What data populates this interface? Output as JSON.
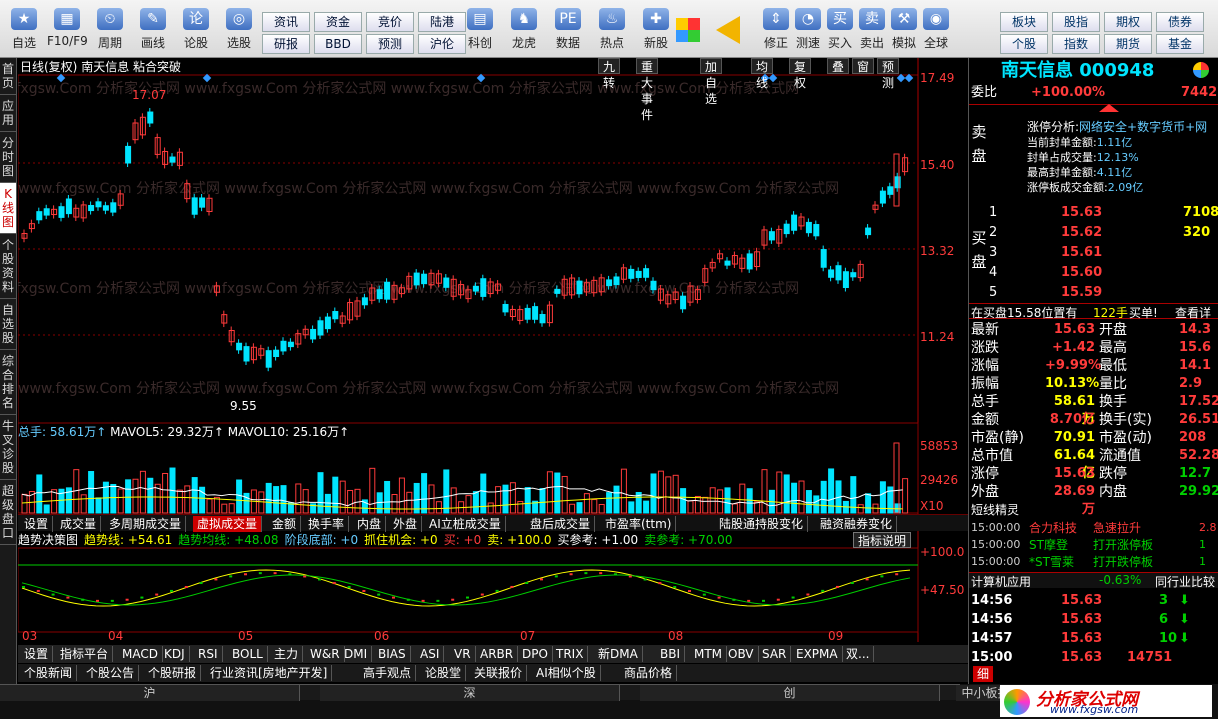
{
  "toolbar": {
    "left": [
      {
        "label": "自选",
        "icon": "★"
      },
      {
        "label": "F10/F9",
        "icon": "▦"
      },
      {
        "label": "周期",
        "icon": "⏲"
      },
      {
        "label": "画线",
        "icon": "✎"
      },
      {
        "label": "论股",
        "icon": "论"
      },
      {
        "label": "选股",
        "icon": "◎"
      }
    ],
    "grid": [
      "资讯",
      "资金",
      "竞价",
      "陆港",
      "研报",
      "BBD",
      "预测",
      "沪伦"
    ],
    "mid": [
      {
        "label": "科创",
        "icon": "▤"
      },
      {
        "label": "龙虎",
        "icon": "♞"
      },
      {
        "label": "数据",
        "icon": "PE"
      },
      {
        "label": "热点",
        "icon": "♨"
      },
      {
        "label": "新股",
        "icon": "✚"
      }
    ],
    "right": [
      {
        "label": "修正",
        "icon": "⇕"
      },
      {
        "label": "测速",
        "icon": "◔"
      },
      {
        "label": "买入",
        "icon": "买"
      },
      {
        "label": "卖出",
        "icon": "卖"
      },
      {
        "label": "模拟",
        "icon": "⚒"
      },
      {
        "label": "全球",
        "icon": "◉"
      }
    ],
    "grid2": [
      "板块",
      "股指",
      "期权",
      "债券",
      "个股",
      "指数",
      "期货",
      "基金"
    ]
  },
  "left_nav": [
    "首页",
    "应用",
    "分时图",
    "K线图",
    "个股资料",
    "自选股",
    "综合排名",
    "牛叉诊股",
    "超级盘口"
  ],
  "chart": {
    "title": "日线(复权)",
    "stock": "南天信息",
    "pattern": "粘合突破",
    "top_buttons": [
      "九转",
      "重大事件",
      "加自选",
      "均线",
      "复权",
      "叠",
      "窗",
      "预测"
    ],
    "price_ticks": [
      "17.49",
      "15.40",
      "13.32",
      "11.24"
    ],
    "high_label": "17.07",
    "low_label": "9.55",
    "vol_label": "总手: 58.61万↑",
    "mavol5": "MAVOL5: 29.32万↑",
    "mavol10": "MAVOL10: 25.16万↑",
    "vol_ticks": [
      "58853",
      "29426",
      "X10"
    ],
    "tabs1": [
      "设置",
      "成交量",
      "多周期成交量",
      "虚拟成交量",
      "金额",
      "换手率",
      "内盘",
      "外盘",
      "AI立桩成交量",
      "盘后成交量",
      "市盈率(ttm)",
      "陆股通持股变化",
      "融资融券变化"
    ],
    "ind_title": "趋势决策图",
    "ind_vals": [
      {
        "t": "趋势线: +54.61",
        "c": "y"
      },
      {
        "t": "趋势均线: +48.08",
        "c": "g"
      },
      {
        "t": "阶段底部: +0",
        "c": "c"
      },
      {
        "t": "抓住机会: +0",
        "c": "y"
      },
      {
        "t": "买: +0",
        "c": "r"
      },
      {
        "t": "卖: +100.0",
        "c": "y"
      },
      {
        "t": "买参考: +1.00",
        "c": "w"
      },
      {
        "t": "卖参考: +70.00",
        "c": "g"
      }
    ],
    "ind_btn": "指标说明",
    "ind_ticks": [
      "+100.0",
      "+47.50"
    ],
    "months": [
      "03",
      "04",
      "05",
      "06",
      "07",
      "08",
      "09"
    ],
    "tabs2": [
      "设置",
      "指标平台",
      "MACD",
      "KDJ",
      "RSI",
      "BOLL",
      "主力",
      "W&R",
      "DMI",
      "BIAS",
      "ASI",
      "VR",
      "ARBR",
      "DPO",
      "TRIX",
      "新DMA",
      "BBI",
      "MTM",
      "OBV",
      "SAR",
      "EXPMA",
      "双..."
    ],
    "tabs3": [
      "个股新闻",
      "个股公告",
      "个股研报",
      "行业资讯[房地产开发]",
      "高手观点",
      "论股堂",
      "关联报价",
      "AI相似个股",
      "商品价格"
    ],
    "watermark": "www.fxgsw.Com 分析家公式网"
  },
  "panel": {
    "name": "南天信息",
    "code": "000948",
    "webi_label": "委比",
    "webi": "+100.00%",
    "webi_r": "7442",
    "limit_title": "涨停分析:",
    "limit_tags": "网络安全+数字货币+网",
    "limit_lines": [
      [
        "当前封单金额:",
        "1.11亿"
      ],
      [
        "封单占成交量:",
        "12.13%"
      ],
      [
        "最高封单金额:",
        "4.11亿"
      ],
      [
        "涨停板成交金额:",
        "2.09亿"
      ]
    ],
    "sell_label": "卖盘",
    "buy_label": "买盘",
    "bids": [
      [
        "1",
        "15.63",
        "7108"
      ],
      [
        "2",
        "15.62",
        "320"
      ],
      [
        "3",
        "15.61",
        ""
      ],
      [
        "4",
        "15.60",
        ""
      ],
      [
        "5",
        "15.59",
        ""
      ]
    ],
    "note": [
      "在买盘15.58位置有",
      "122手",
      "买单!",
      "查看详"
    ],
    "stats": [
      [
        "最新",
        "15.63",
        "开盘",
        "14.3"
      ],
      [
        "涨跌",
        "+1.42",
        "最高",
        "15.6"
      ],
      [
        "涨幅",
        "+9.99%",
        "最低",
        "14.1"
      ],
      [
        "振幅",
        "10.13%",
        "量比",
        "2.9"
      ],
      [
        "总手",
        "58.61万",
        "换手",
        "17.52"
      ],
      [
        "金额",
        "8.70亿",
        "换手(实)",
        "26.51"
      ],
      [
        "市盈(静)",
        "70.91",
        "市盈(动)",
        "208"
      ],
      [
        "总市值",
        "61.64亿",
        "流通值",
        "52.28"
      ],
      [
        "涨停",
        "15.63",
        "跌停",
        "12.7"
      ],
      [
        "外盘",
        "28.69万",
        "内盘",
        "29.92"
      ]
    ],
    "dx_title": "短线精灵",
    "dx": [
      [
        "15:00:00",
        "合力科技",
        "急速拉升",
        "2.8"
      ],
      [
        "15:00:00",
        "ST摩登",
        "打开涨停板",
        "1"
      ],
      [
        "15:00:00",
        "*ST雪莱",
        "打开跌停板",
        "1"
      ]
    ],
    "industry": [
      "计算机应用",
      "-0.63%",
      "同行业比较"
    ],
    "ticks": [
      [
        "14:56",
        "15.63",
        "3"
      ],
      [
        "14:56",
        "15.63",
        "6"
      ],
      [
        "14:57",
        "15.63",
        "10"
      ],
      [
        "15:00",
        "15.63",
        "14751"
      ]
    ],
    "bottom_tab": "细"
  },
  "statusbar": {
    "items": [
      "沪",
      "深",
      "创",
      "中小板指"
    ]
  },
  "brand": {
    "name": "分析家公式网",
    "url": "www.fxgsw.com"
  }
}
